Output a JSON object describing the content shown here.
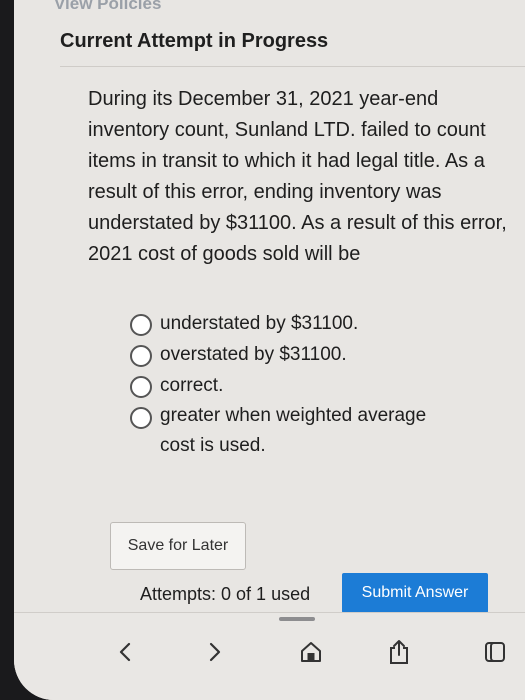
{
  "top_link": "View Policies",
  "heading": "Current Attempt in Progress",
  "question": "During its December 31, 2021 year-end inventory count, Sunland LTD. failed to count items in transit to which it had legal title. As a result of this error, ending inventory was understated by $31100. As a result of this error, 2021 cost of goods sold will be",
  "options": [
    "understated by $31100.",
    "overstated by $31100.",
    "correct.",
    "greater when weighted average cost is used."
  ],
  "save_button": "Save for Later",
  "attempts": "Attempts: 0 of 1 used",
  "submit_button": "Submit Answer",
  "toolbar_icons": [
    "back-icon",
    "forward-icon",
    "home-icon",
    "share-icon",
    "tabs-icon"
  ]
}
